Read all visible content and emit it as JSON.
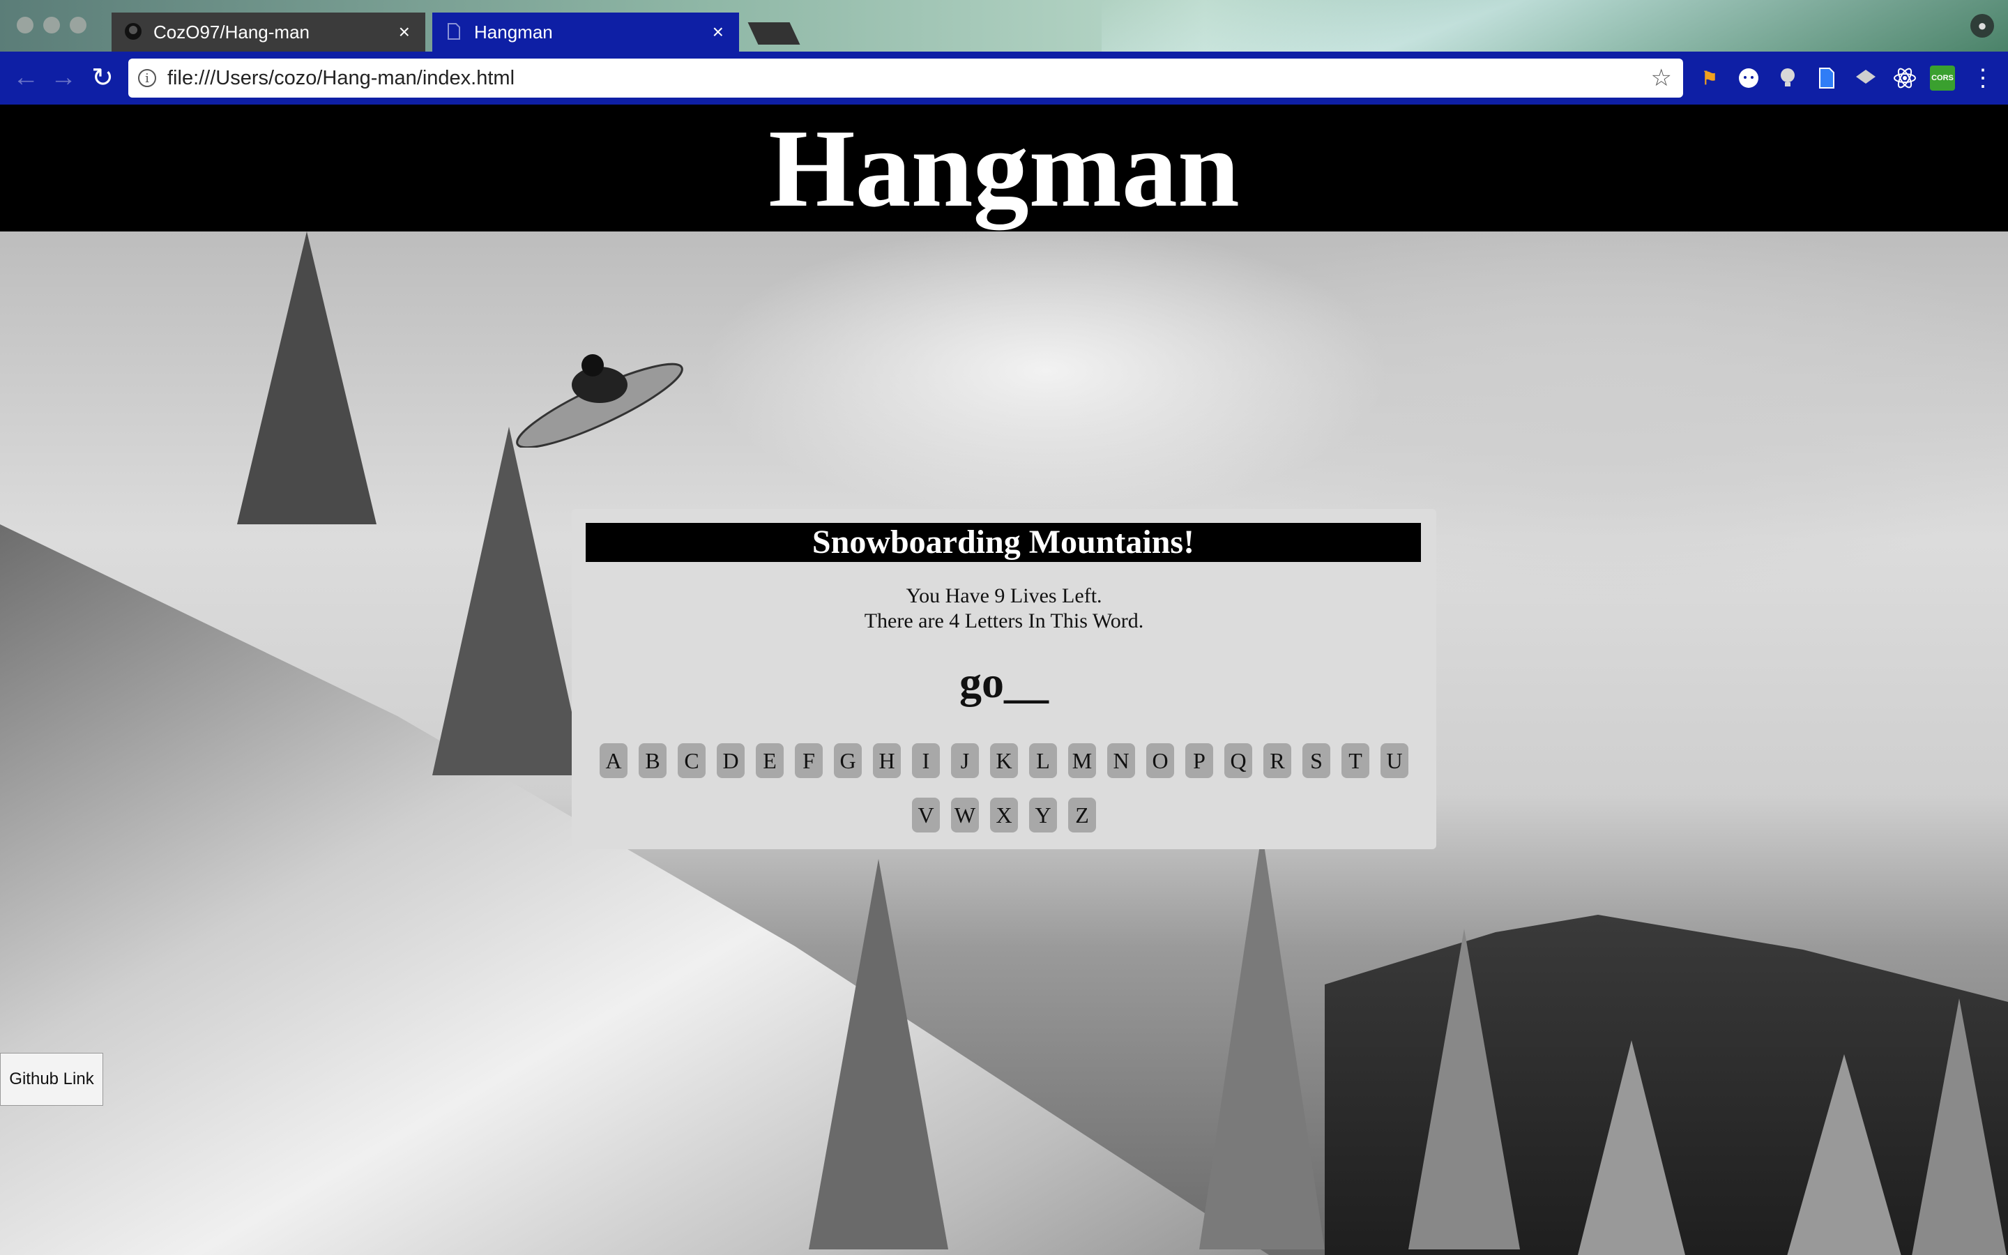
{
  "browser": {
    "tabs": [
      {
        "title": "CozO97/Hang-man",
        "active": false
      },
      {
        "title": "Hangman",
        "active": true
      }
    ],
    "address_bar": {
      "url": "file:///Users/cozo/Hang-man/index.html"
    },
    "close_glyph": "×",
    "extensions": [
      "flag-icon",
      "ghost-icon",
      "lightbulb-icon",
      "document-icon",
      "layers-icon",
      "react-icon",
      "cors-icon",
      "menu-icon"
    ],
    "cors_label": "CORS"
  },
  "page": {
    "header_title": "Hangman",
    "panel": {
      "category": "Snowboarding Mountains!",
      "lives_text": "You Have 9 Lives Left.",
      "letters_text": "There are 4 Letters In This Word.",
      "word_display": "go__",
      "keys_row1": [
        "A",
        "B",
        "C",
        "D",
        "E",
        "F",
        "G",
        "H",
        "I",
        "J",
        "K",
        "L",
        "M",
        "N",
        "O",
        "P",
        "Q",
        "R",
        "S",
        "T",
        "U"
      ],
      "keys_row2": [
        "V",
        "W",
        "X",
        "Y",
        "Z"
      ]
    },
    "github_link_label": "Github Link"
  },
  "colors": {
    "toolbar": "#0e1fa5",
    "header_bg": "#000000",
    "panel_bg": "#dcdcdc",
    "key_bg": "#a8a8a8"
  }
}
